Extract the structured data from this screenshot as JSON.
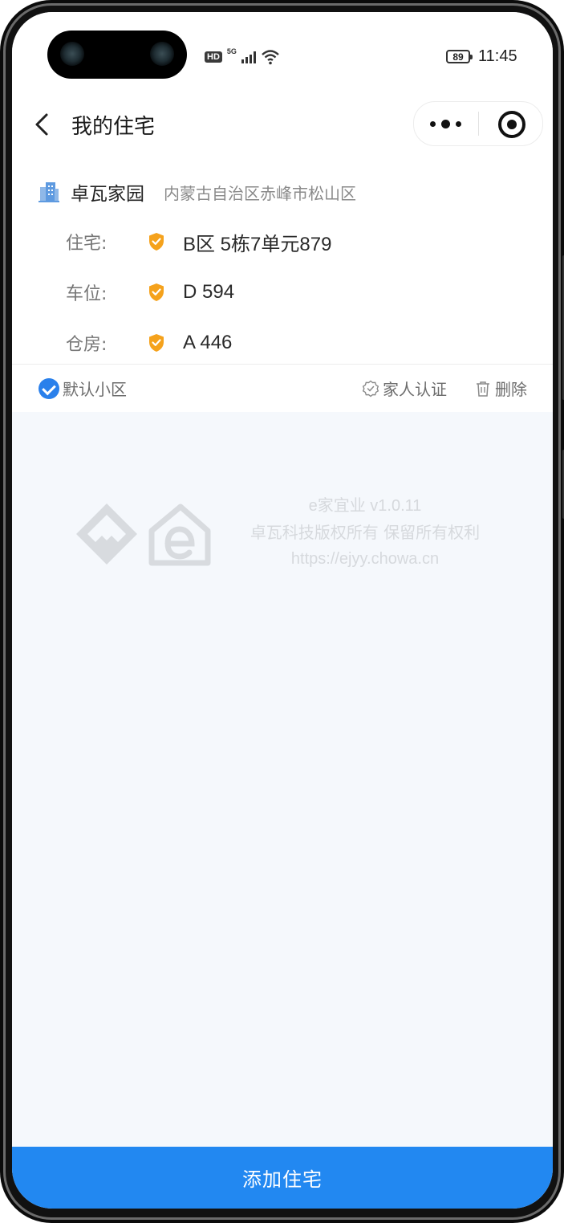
{
  "status_bar": {
    "hd_label": "HD",
    "network_label": "5G",
    "battery_level": "89",
    "time": "11:45"
  },
  "navbar": {
    "title": "我的住宅",
    "more_icon": "more-dots-icon",
    "close_icon": "target-close-icon"
  },
  "community": {
    "icon": "building-icon",
    "name": "卓瓦家园",
    "address": "内蒙古自治区赤峰市松山区",
    "properties": [
      {
        "label": "住宅:",
        "value": "B区 5栋7单元879",
        "icon": "verified-shield-icon"
      },
      {
        "label": "车位:",
        "value": "D 594",
        "icon": "verified-shield-icon"
      },
      {
        "label": "仓房:",
        "value": "A 446",
        "icon": "verified-shield-icon"
      }
    ],
    "actions": {
      "default_label": "默认小区",
      "family_label": "家人认证",
      "delete_label": "删除"
    }
  },
  "watermark": {
    "line1": "e家宜业 v1.0.11",
    "line2": "卓瓦科技版权所有 保留所有权利",
    "line3": "https://ejyy.chowa.cn"
  },
  "footer": {
    "add_button_label": "添加住宅"
  },
  "colors": {
    "primary": "#2288f1",
    "check_blue": "#2a80eb",
    "shield_orange": "#f5a21c",
    "background": "#f5f8fc"
  }
}
